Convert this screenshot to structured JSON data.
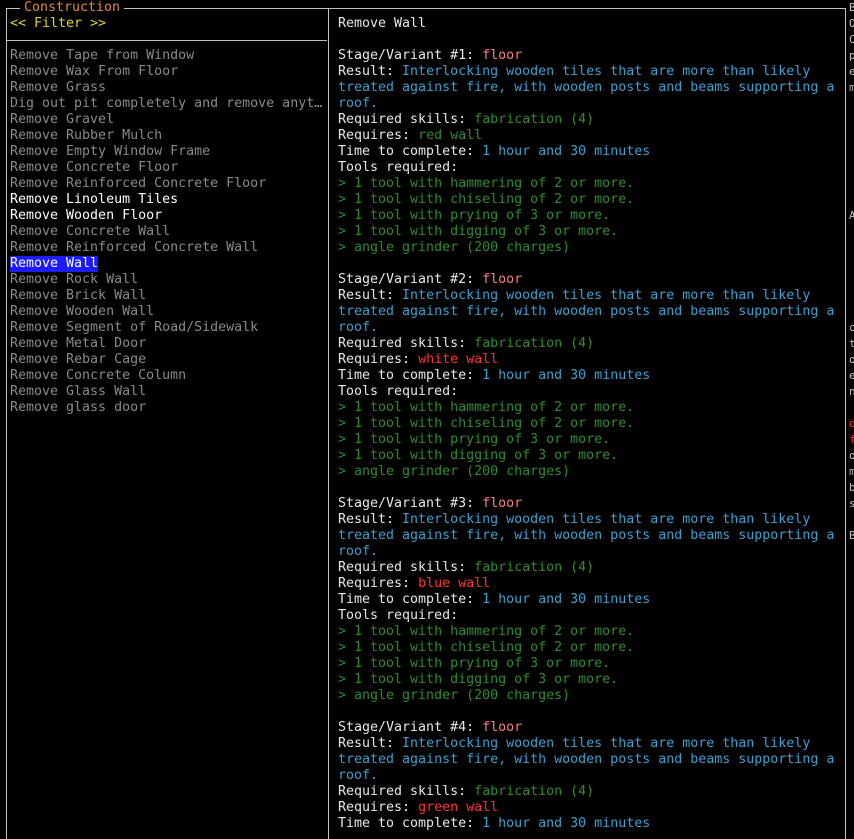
{
  "panel": {
    "title": "Construction",
    "filter": "<< Filter >>"
  },
  "list": [
    {
      "label": "Remove Tape from Window",
      "state": "unavailable"
    },
    {
      "label": "Remove Wax From Floor",
      "state": "unavailable"
    },
    {
      "label": "Remove Grass",
      "state": "unavailable"
    },
    {
      "label": "Dig out pit completely and remove anyt…",
      "state": "unavailable"
    },
    {
      "label": "Remove Gravel",
      "state": "unavailable"
    },
    {
      "label": "Remove Rubber Mulch",
      "state": "unavailable"
    },
    {
      "label": "Remove Empty Window Frame",
      "state": "unavailable"
    },
    {
      "label": "Remove Concrete Floor",
      "state": "unavailable"
    },
    {
      "label": "Remove Reinforced Concrete Floor",
      "state": "unavailable"
    },
    {
      "label": "Remove Linoleum Tiles",
      "state": "available"
    },
    {
      "label": "Remove Wooden Floor",
      "state": "available"
    },
    {
      "label": "Remove Concrete Wall",
      "state": "unavailable"
    },
    {
      "label": "Remove Reinforced Concrete Wall",
      "state": "unavailable"
    },
    {
      "label": "Remove Wall",
      "state": "selected"
    },
    {
      "label": "Remove Rock Wall",
      "state": "unavailable"
    },
    {
      "label": "Remove Brick Wall",
      "state": "unavailable"
    },
    {
      "label": "Remove Wooden Wall",
      "state": "unavailable"
    },
    {
      "label": "Remove Segment of Road/Sidewalk",
      "state": "unavailable"
    },
    {
      "label": "Remove Metal Door",
      "state": "unavailable"
    },
    {
      "label": "Remove Rebar Cage",
      "state": "unavailable"
    },
    {
      "label": "Remove Concrete Column",
      "state": "unavailable"
    },
    {
      "label": "Remove Glass Wall",
      "state": "unavailable"
    },
    {
      "label": "Remove glass door",
      "state": "unavailable"
    }
  ],
  "detail": {
    "title": "Remove Wall",
    "labels": {
      "result": "Result: ",
      "skills": "Required skills: ",
      "requires": "Requires: ",
      "time": "Time to complete: ",
      "tools": "Tools required:"
    },
    "variants": [
      {
        "stage": "Stage/Variant #1: ",
        "kind": "floor",
        "result": [
          "Interlocking wooden tiles that are more than likely",
          "treated against fire, with wooden posts and beams supporting a",
          "roof."
        ],
        "skills": "fabrication (4)",
        "requires": "red wall",
        "time": "1 hour and 30 minutes",
        "tools": [
          "> 1 tool with hammering of 2 or more.",
          "> 1 tool with chiseling of 2 or more.",
          "> 1 tool with prying of 3 or more.",
          "> 1 tool with digging of 3 or more.",
          "> angle grinder (200 charges)"
        ]
      },
      {
        "stage": "Stage/Variant #2: ",
        "kind": "floor",
        "result": [
          "Interlocking wooden tiles that are more than likely",
          "treated against fire, with wooden posts and beams supporting a",
          "roof."
        ],
        "skills": "fabrication (4)",
        "requires": "white wall",
        "time": "1 hour and 30 minutes",
        "tools": [
          "> 1 tool with hammering of 2 or more.",
          "> 1 tool with chiseling of 2 or more.",
          "> 1 tool with prying of 3 or more.",
          "> 1 tool with digging of 3 or more.",
          "> angle grinder (200 charges)"
        ]
      },
      {
        "stage": "Stage/Variant #3: ",
        "kind": "floor",
        "result": [
          "Interlocking wooden tiles that are more than likely",
          "treated against fire, with wooden posts and beams supporting a",
          "roof."
        ],
        "skills": "fabrication (4)",
        "requires": "blue wall",
        "time": "1 hour and 30 minutes",
        "tools": [
          "> 1 tool with hammering of 2 or more.",
          "> 1 tool with chiseling of 2 or more.",
          "> 1 tool with prying of 3 or more.",
          "> 1 tool with digging of 3 or more.",
          "> angle grinder (200 charges)"
        ]
      },
      {
        "stage": "Stage/Variant #4: ",
        "kind": "floor",
        "result": [
          "Interlocking wooden tiles that are more than likely",
          "treated against fire, with wooden posts and beams supporting a",
          "roof."
        ],
        "skills": "fabrication (4)",
        "requires": "green wall",
        "time": "1 hour and 30 minutes",
        "tools": []
      }
    ]
  },
  "edge_text": [
    "B",
    "O",
    "C",
    "p",
    "e",
    "m",
    "",
    "",
    "",
    "",
    "",
    "",
    "",
    "A",
    "",
    "",
    "",
    "",
    "",
    "",
    "c",
    "t",
    "o",
    "e",
    "n",
    "",
    "o",
    "f",
    "o",
    "m",
    "b",
    "s",
    "",
    "B",
    "",
    "",
    "",
    ""
  ]
}
